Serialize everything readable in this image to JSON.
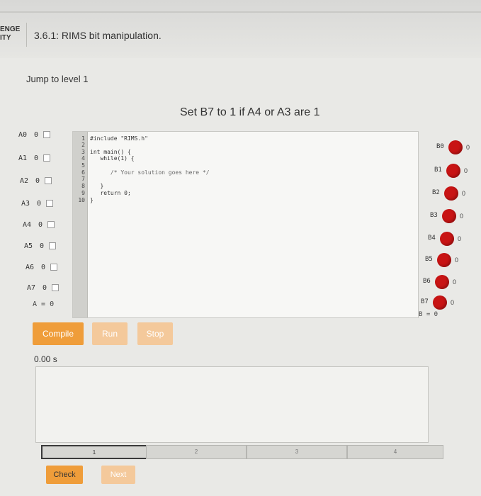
{
  "header": {
    "challenge_label_1": "ENGE",
    "challenge_label_2": "ITY",
    "title": "3.6.1: RIMS bit manipulation."
  },
  "jump_to_level": "Jump to level 1",
  "task": "Set B7 to 1 if A4 or A3 are 1",
  "inputs": [
    {
      "name": "A0",
      "value": "0"
    },
    {
      "name": "A1",
      "value": "0"
    },
    {
      "name": "A2",
      "value": "0"
    },
    {
      "name": "A3",
      "value": "0"
    },
    {
      "name": "A4",
      "value": "0"
    },
    {
      "name": "A5",
      "value": "0"
    },
    {
      "name": "A6",
      "value": "0"
    },
    {
      "name": "A7",
      "value": "0"
    }
  ],
  "input_total": "A = 0",
  "editor": {
    "line_numbers": [
      "1",
      "2",
      "3",
      "4",
      "5",
      "6",
      "7",
      "8",
      "9",
      "10"
    ],
    "lines": [
      "#include \"RIMS.h\"",
      "",
      "int main() {",
      "   while(1) {",
      "",
      "      /* Your solution goes here */",
      "",
      "   }",
      "   return 0;",
      "}"
    ]
  },
  "outputs": [
    {
      "name": "B0",
      "value": "0"
    },
    {
      "name": "B1",
      "value": "0"
    },
    {
      "name": "B2",
      "value": "0"
    },
    {
      "name": "B3",
      "value": "0"
    },
    {
      "name": "B4",
      "value": "0"
    },
    {
      "name": "B5",
      "value": "0"
    },
    {
      "name": "B6",
      "value": "0"
    },
    {
      "name": "B7",
      "value": "0"
    }
  ],
  "output_total": "B = 0",
  "buttons": {
    "compile": "Compile",
    "run": "Run",
    "stop": "Stop",
    "check": "Check",
    "next": "Next"
  },
  "timer": "0.00 s",
  "levels": [
    "1",
    "2",
    "3",
    "4"
  ],
  "colors": {
    "accent": "#ef9d3a",
    "accent_light": "#f4c99b",
    "led_on": "#c81414"
  }
}
